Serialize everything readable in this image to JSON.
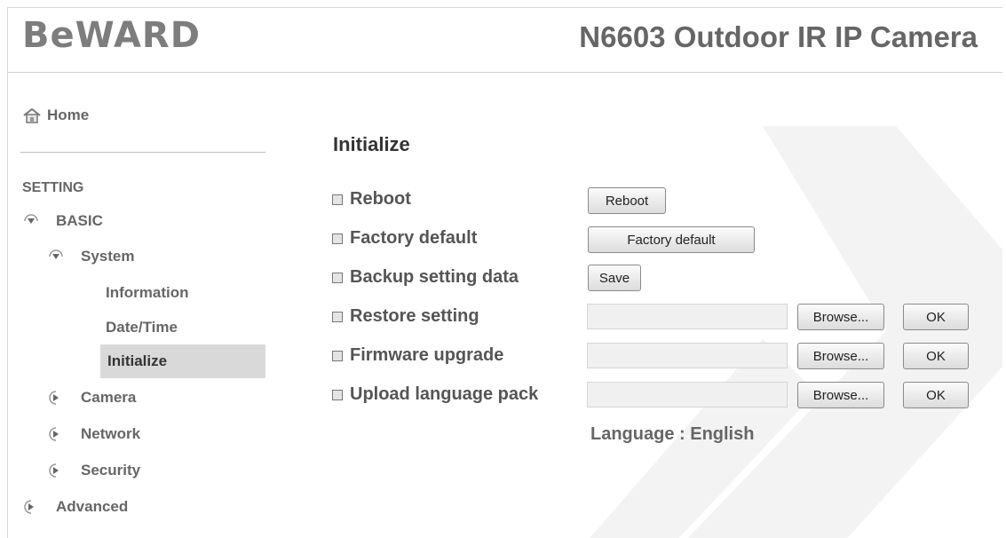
{
  "header": {
    "logo": "BeWARD",
    "product_title": "N6603 Outdoor IR IP Camera"
  },
  "sidebar": {
    "home": "Home",
    "section_label": "SETTING",
    "basic": "BASIC",
    "system": "System",
    "information": "Information",
    "datetime": "Date/Time",
    "initialize": "Initialize",
    "camera": "Camera",
    "network": "Network",
    "security": "Security",
    "advanced": "Advanced"
  },
  "main": {
    "heading": "Initialize",
    "rows": {
      "reboot": {
        "label": "Reboot",
        "button": "Reboot"
      },
      "factory": {
        "label": "Factory default",
        "button": "Factory default"
      },
      "backup": {
        "label": "Backup setting data",
        "button": "Save"
      },
      "restore": {
        "label": "Restore setting",
        "browse": "Browse...",
        "ok": "OK"
      },
      "firmware": {
        "label": "Firmware upgrade",
        "browse": "Browse...",
        "ok": "OK"
      },
      "language_pack": {
        "label": "Upload language pack",
        "browse": "Browse...",
        "ok": "OK"
      }
    },
    "language": "Language : English"
  }
}
